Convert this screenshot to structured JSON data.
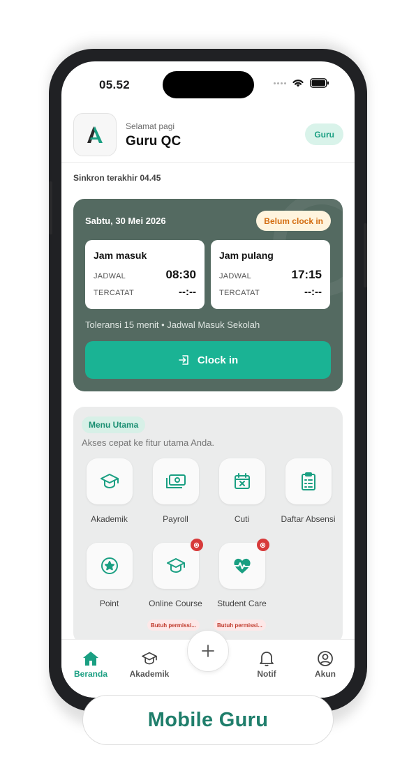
{
  "status_bar": {
    "time": "05.52"
  },
  "header": {
    "greeting": "Selamat pagi",
    "user_name": "Guru QC",
    "role_badge": "Guru",
    "sync_text": "Sinkron terakhir 04.45"
  },
  "attendance": {
    "date": "Sabtu, 30 Mei 2026",
    "status": "Belum clock in",
    "check_in": {
      "title": "Jam masuk",
      "schedule_label": "JADWAL",
      "schedule_value": "08:30",
      "recorded_label": "TERCATAT",
      "recorded_value": "--:--"
    },
    "check_out": {
      "title": "Jam pulang",
      "schedule_label": "JADWAL",
      "schedule_value": "17:15",
      "recorded_label": "TERCATAT",
      "recorded_value": "--:--"
    },
    "tolerance": "Toleransi 15 menit • Jadwal Masuk Sekolah",
    "clock_button": "Clock in"
  },
  "menu": {
    "badge": "Menu Utama",
    "subtitle": "Akses cepat ke fitur utama Anda.",
    "items": [
      {
        "label": "Akademik",
        "icon": "graduation-cap-icon"
      },
      {
        "label": "Payroll",
        "icon": "money-icon"
      },
      {
        "label": "Cuti",
        "icon": "calendar-x-icon"
      },
      {
        "label": "Daftar Absensi",
        "icon": "clipboard-list-icon"
      },
      {
        "label": "Point",
        "icon": "star-badge-icon"
      },
      {
        "label": "Online Course",
        "icon": "graduation-cap-icon",
        "tag": "Butuh permissi..."
      },
      {
        "label": "Student Care",
        "icon": "heart-pulse-icon",
        "tag": "Butuh permissi..."
      }
    ]
  },
  "bottom_nav": {
    "items": [
      {
        "label": "Beranda",
        "icon": "home-icon",
        "active": true
      },
      {
        "label": "Akademik",
        "icon": "graduation-cap-icon"
      },
      {
        "label": "Notif",
        "icon": "bell-icon"
      },
      {
        "label": "Akun",
        "icon": "user-circle-icon"
      }
    ]
  },
  "caption": "Mobile Guru",
  "colors": {
    "accent": "#1ab394",
    "card": "#546a61",
    "warning": "#d36c10",
    "danger": "#d73a3a"
  }
}
